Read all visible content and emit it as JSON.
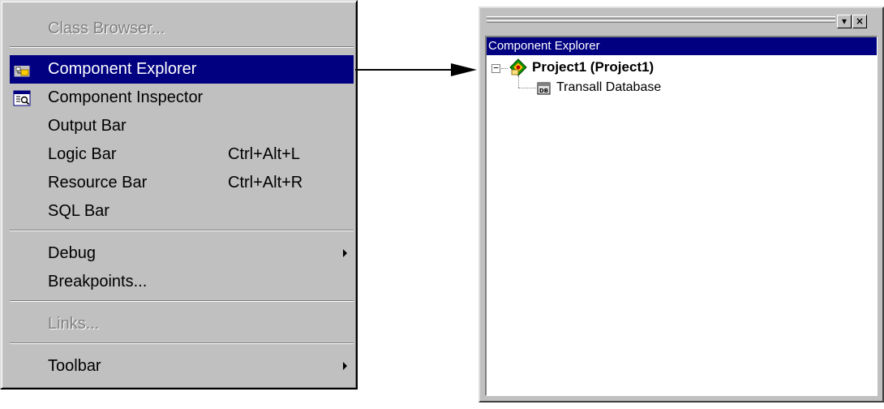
{
  "menu": {
    "items": [
      {
        "label": "Class Browser...",
        "shortcut": "",
        "disabled": true
      },
      {
        "label": "Component Explorer",
        "shortcut": "",
        "selected": true,
        "icon": "component-explorer-icon"
      },
      {
        "label": "Component Inspector",
        "shortcut": "",
        "icon": "component-inspector-icon"
      },
      {
        "label": "Output Bar",
        "shortcut": ""
      },
      {
        "label": "Logic Bar",
        "shortcut": "Ctrl+Alt+L"
      },
      {
        "label": "Resource Bar",
        "shortcut": "Ctrl+Alt+R"
      },
      {
        "label": "SQL Bar",
        "shortcut": ""
      },
      {
        "label": "Debug",
        "shortcut": "",
        "submenu": true
      },
      {
        "label": "Breakpoints...",
        "shortcut": ""
      },
      {
        "label": "Links...",
        "shortcut": "",
        "disabled": true
      },
      {
        "label": "Toolbar",
        "shortcut": "",
        "submenu": true
      }
    ]
  },
  "explorer": {
    "title": "Component Explorer",
    "tree": {
      "root": {
        "label": "Project1 (Project1)",
        "icon": "project-icon",
        "expander": "−"
      },
      "children": [
        {
          "label": "Transall Database",
          "icon": "database-icon",
          "badge": "DB"
        }
      ]
    },
    "buttons": {
      "dock": "▾",
      "close": "×"
    }
  },
  "colors": {
    "menu_bg": "#c0c0c0",
    "highlight": "#000080",
    "highlight_text": "#ffffff",
    "disabled_text": "#808080"
  }
}
